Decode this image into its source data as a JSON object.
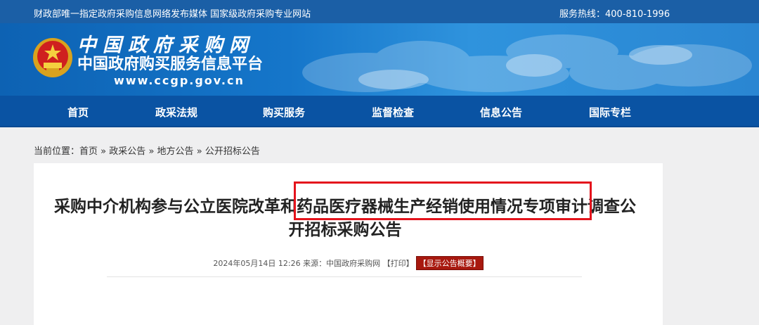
{
  "topbar": {
    "left_text": "财政部唯一指定政府采购信息网络发布媒体 国家级政府采购专业网站",
    "hotline": "服务热线：400-810-1996"
  },
  "logo": {
    "title": "中国政府采购网",
    "subtitle": "中国政府购买服务信息平台",
    "url": "www.ccgp.gov.cn"
  },
  "nav": {
    "items": [
      "首页",
      "政采法规",
      "购买服务",
      "监督检查",
      "信息公告",
      "国际专栏"
    ]
  },
  "breadcrumb": {
    "prefix": "当前位置：",
    "home": "首页",
    "sep1": "»",
    "l1": "政采公告",
    "sep2": "»",
    "l2": "地方公告",
    "sep3": "»",
    "l3": "公开招标公告"
  },
  "article": {
    "title": "采购中介机构参与公立医院改革和药品医疗器械生产经销使用情况专项审计调查公开招标采购公告",
    "datetime": "2024年05月14日 12:26",
    "source_label": "来源：",
    "source": "中国政府采购网",
    "print_label": "【打印】",
    "summary_label": "【显示公告概要】"
  },
  "colors": {
    "topbar": "#1b5fa6",
    "nav": "#0a53a3",
    "highlight_border": "#e4131c",
    "summary_button": "#a8190f"
  }
}
